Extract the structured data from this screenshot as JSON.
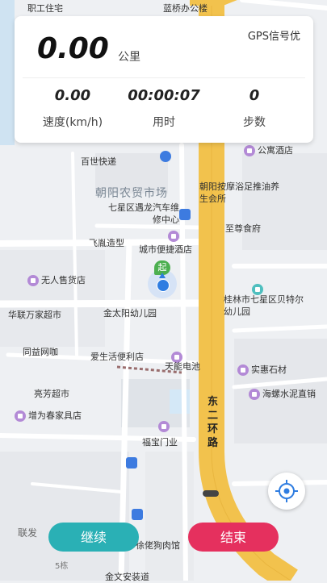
{
  "stats": {
    "distance": "0.00",
    "distance_unit": "公里",
    "gps_status": "GPS信号优",
    "speed": "0.00",
    "speed_label": "速度(km/h)",
    "duration": "00:00:07",
    "duration_label": "用时",
    "steps": "0",
    "steps_label": "步数"
  },
  "buttons": {
    "continue": "继续",
    "end": "结束"
  },
  "map": {
    "start_marker": "起",
    "road_label": "东二环路",
    "area_label": "朝阳农贸市场",
    "pois": [
      "职工住宅",
      "蓝桥办公楼",
      "百世快递",
      "朝阳按摩浴足推油养生会所",
      "公寓酒店",
      "七星区遇龙汽车维修中心",
      "至尊食府",
      "飞胤造型",
      "城市便捷酒店",
      "无人售货店",
      "桂林市七星区贝特尔幼儿园",
      "华联万家超市",
      "金太阳幼儿园",
      "同益网咖",
      "爱生活便利店",
      "天能电池",
      "实惠石材",
      "亮芳超市",
      "海螺水泥直销",
      "增为春家具店",
      "福宝门业",
      "联发",
      "徐佬狗肉馆",
      "5栋",
      "金文安装道"
    ]
  },
  "colors": {
    "continue_button": "#2ab0b5",
    "end_button": "#e5305e",
    "main_road": "#f2c24d",
    "start_marker": "#4caf50",
    "location_dot": "#2f7de1"
  }
}
